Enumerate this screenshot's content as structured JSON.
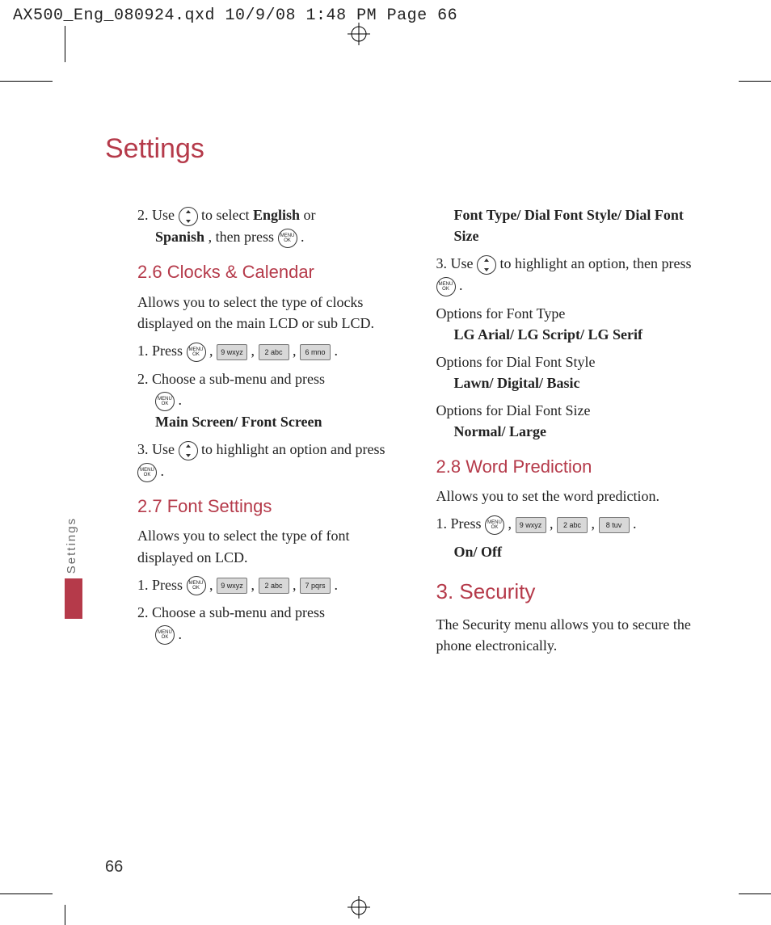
{
  "print_header": "AX500_Eng_080924.qxd  10/9/08  1:48 PM  Page 66",
  "page_title": "Settings",
  "side_tab": "Settings",
  "page_number": "66",
  "keys": {
    "ok_top": "MENU",
    "ok_bottom": "OK",
    "k9": "9 wxyz",
    "k2": "2 abc",
    "k6": "6 mno",
    "k7": "7 pqrs",
    "k8": "8 tuv"
  },
  "left": {
    "step2a": "2. Use ",
    "step2b": " to select ",
    "step2_bold1": "English",
    "step2c": " or ",
    "step2_bold2": "Spanish",
    "step2d": ", then press ",
    "step2e": ".",
    "h26": "2.6 Clocks & Calendar",
    "p26": "Allows you to select the type of clocks displayed on the main LCD or sub LCD.",
    "s26_1a": "1. Press ",
    "comma": " , ",
    "period": " .",
    "s26_2": "2. Choose a sub-menu and press ",
    "s26_2b": ".",
    "s26_2_bold": "Main Screen/ Front Screen",
    "s26_3a": "3. Use ",
    "s26_3b": " to highlight an option and press ",
    "s26_3c": " .",
    "h27": "2.7 Font Settings",
    "p27": "Allows you to select the type of font displayed on LCD.",
    "s27_1a": "1. Press ",
    "s27_2": "2. Choose a sub-menu and press ",
    "s27_2b": "."
  },
  "right": {
    "r_bold1": "Font Type/ Dial Font Style/ Dial Font Size",
    "r3a": "3. Use ",
    "r3b": " to highlight an option, then press ",
    "r3c": " .",
    "opt_ft_label": "Options for Font Type",
    "opt_ft_bold": "LG Arial/ LG Script/ LG Serif",
    "opt_dfs_label": "Options for Dial Font Style",
    "opt_dfs_bold": "Lawn/ Digital/ Basic",
    "opt_dsz_label": "Options for Dial Font Size",
    "opt_dsz_bold": "Normal/ Large",
    "h28": "2.8 Word Prediction",
    "p28": "Allows you to set the word prediction.",
    "s28_1a": "1. Press ",
    "s28_bold": "On/ Off",
    "h3": "3. Security",
    "p3": "The Security menu allows you to secure the phone electronically."
  }
}
